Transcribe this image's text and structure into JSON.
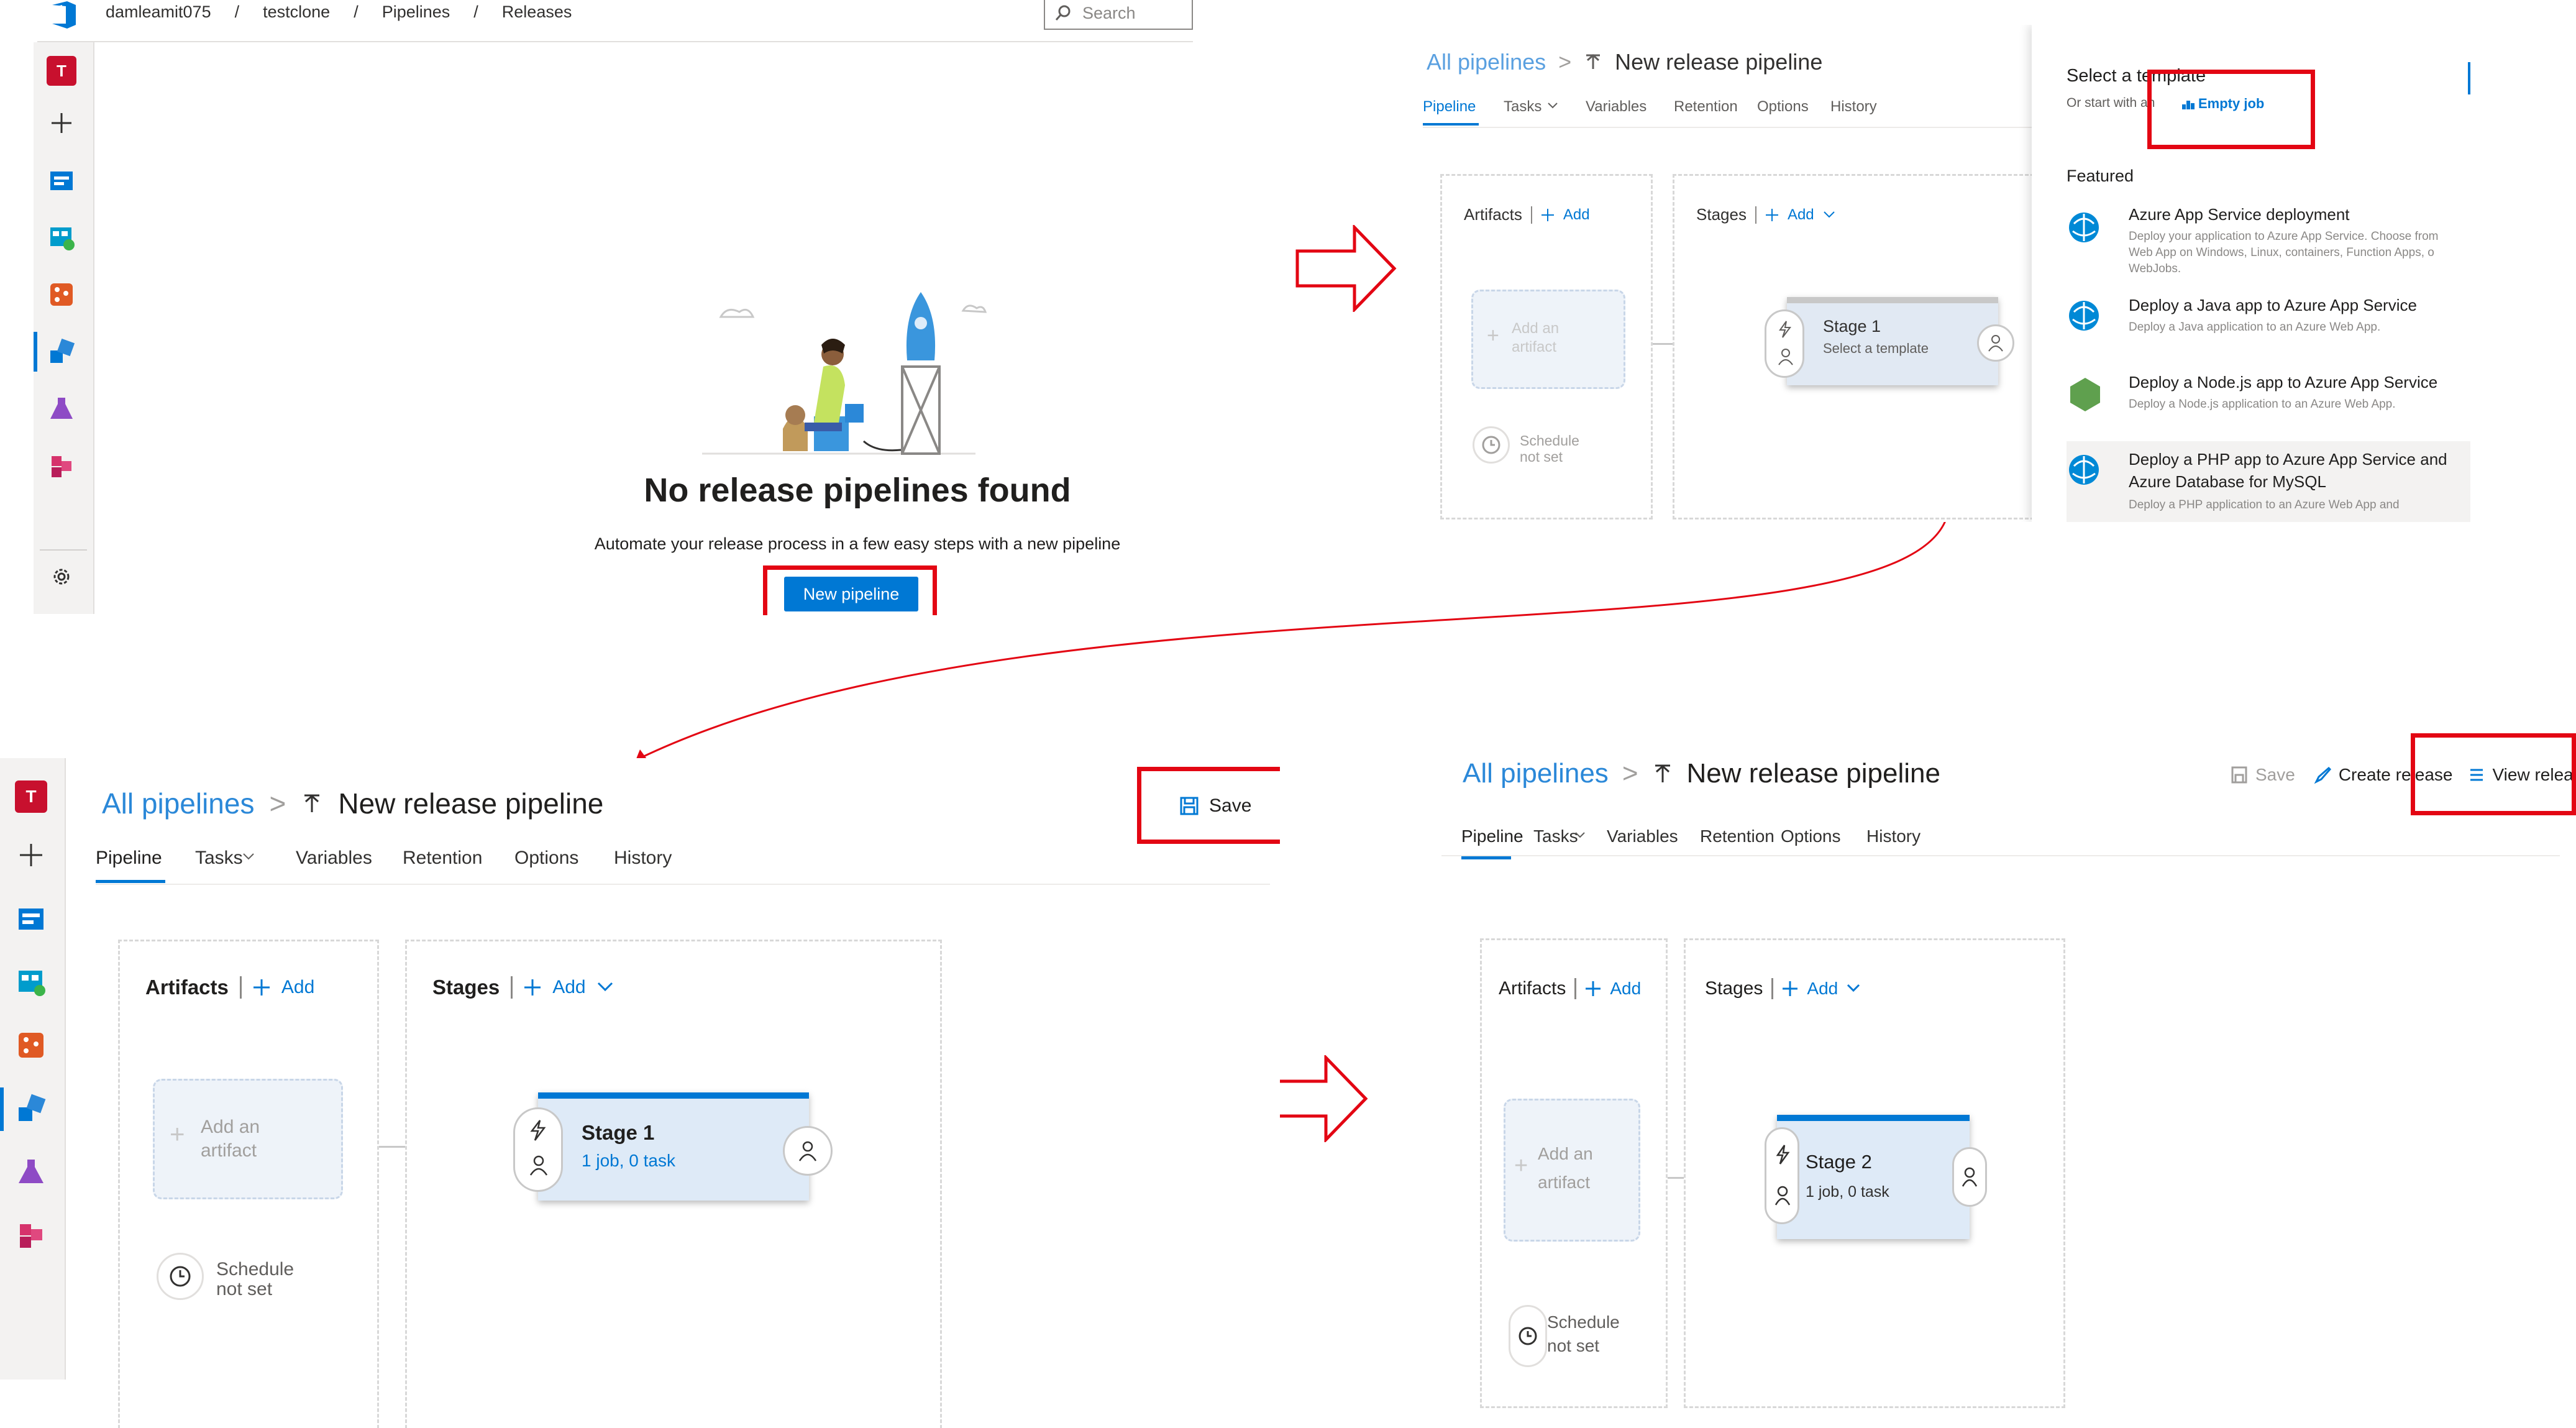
{
  "p1": {
    "breadcrumb": [
      "damleamit075",
      "/",
      "testclone",
      "/",
      "Pipelines",
      "/",
      "Releases"
    ],
    "search_placeholder": "Search",
    "avatar_letter": "T",
    "heading": "No release pipelines found",
    "subtext": "Automate your release process in a few easy steps with a new pipeline",
    "new_pipeline_label": "New pipeline"
  },
  "p2": {
    "all_pipelines": "All pipelines",
    "chevron": ">",
    "title": "New release pipeline",
    "tabs": [
      "Pipeline",
      "Tasks",
      "Variables",
      "Retention",
      "Options",
      "History"
    ],
    "artifacts_label": "Artifacts",
    "add_label": "Add",
    "stages_label": "Stages",
    "add_artifact": [
      "Add an",
      "artifact"
    ],
    "schedule": [
      "Schedule",
      "not set"
    ],
    "stage_name": "Stage 1",
    "stage_sub": "Select a template",
    "template_panel": {
      "heading": "Select a template",
      "or_start": "Or start with an",
      "empty_job": "Empty job",
      "featured": "Featured",
      "items": [
        {
          "title": "Azure App Service deployment",
          "desc": [
            "Deploy your application to Azure App Service. Choose from",
            "Web App on Windows, Linux, containers, Function Apps, o",
            "WebJobs."
          ]
        },
        {
          "title": "Deploy a Java app to Azure App Service",
          "desc": [
            "Deploy a Java application to an Azure Web App."
          ]
        },
        {
          "title": "Deploy a Node.js app to Azure App Service",
          "desc": [
            "Deploy a Node.js application to an Azure Web App."
          ]
        },
        {
          "title": "Deploy a PHP app to Azure App Service and",
          "title2": "Azure Database for MySQL",
          "desc": [
            "Deploy a PHP application to an Azure Web App and"
          ]
        }
      ]
    }
  },
  "p3": {
    "avatar_letter": "T",
    "all_pipelines": "All pipelines",
    "chevron": ">",
    "title": "New release pipeline",
    "save_label": "Save",
    "tabs": [
      "Pipeline",
      "Tasks",
      "Variables",
      "Retention",
      "Options",
      "History"
    ],
    "artifacts_label": "Artifacts",
    "add_label": "Add",
    "stages_label": "Stages",
    "add_artifact": [
      "Add an",
      "artifact"
    ],
    "schedule": [
      "Schedule",
      "not set"
    ],
    "stage_name": "Stage 1",
    "stage_sub": "1 job, 0 task"
  },
  "p4": {
    "all_pipelines": "All pipelines",
    "chevron": ">",
    "title": "New release pipeline",
    "save_label": "Save",
    "create_release": "Create release",
    "view_releases": "View releases",
    "more": "···",
    "tabs": [
      "Pipeline",
      "Tasks",
      "Variables",
      "Retention",
      "Options",
      "History"
    ],
    "artifacts_label": "Artifacts",
    "add_label": "Add",
    "stages_label": "Stages",
    "add_artifact": [
      "Add an",
      "artifact"
    ],
    "schedule": [
      "Schedule",
      "not set"
    ],
    "stage_name": "Stage 2",
    "stage_sub": "1 job, 0 task"
  },
  "colors": {
    "accent": "#0078d4",
    "highlight": "#e30613"
  }
}
